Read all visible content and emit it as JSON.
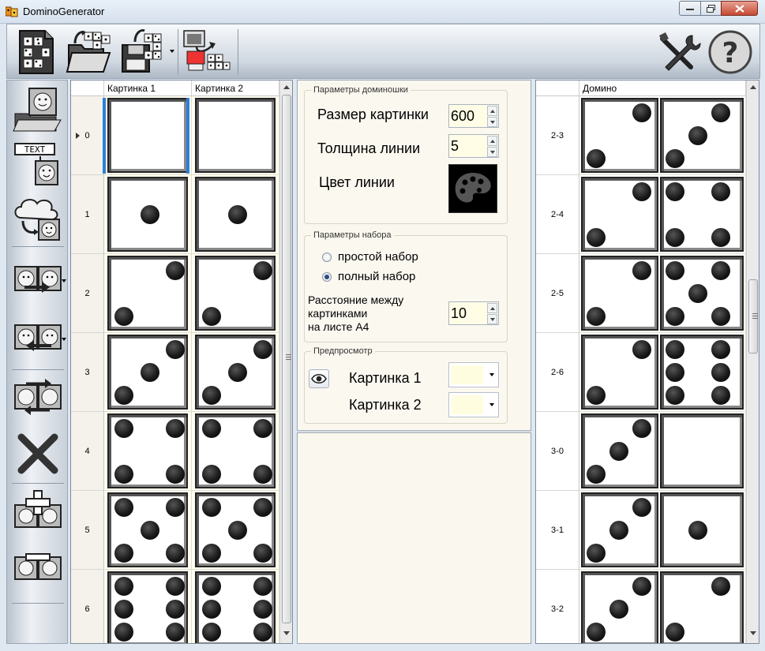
{
  "window": {
    "title": "DominoGenerator"
  },
  "left_grid": {
    "columns": [
      "Картинка 1",
      "Картинка 2"
    ],
    "rows": [
      {
        "label": "0",
        "pips1": 0,
        "pips2": 0
      },
      {
        "label": "1",
        "pips1": 1,
        "pips2": 1
      },
      {
        "label": "2",
        "pips1": 2,
        "pips2": 2
      },
      {
        "label": "3",
        "pips1": 3,
        "pips2": 3
      },
      {
        "label": "4",
        "pips1": 4,
        "pips2": 4
      },
      {
        "label": "5",
        "pips1": 5,
        "pips2": 5
      },
      {
        "label": "6",
        "pips1": 6,
        "pips2": 6
      }
    ]
  },
  "domino_params": {
    "title": "Параметры доминошки",
    "image_size_label": "Размер картинки",
    "image_size_value": "600",
    "line_width_label": "Толщина линии",
    "line_width_value": "5",
    "line_color_label": "Цвет линии"
  },
  "set_params": {
    "title": "Параметры набора",
    "option_simple": "простой набор",
    "option_full": "полный набор",
    "selected": "full",
    "spacing_label_1": "Расстояние между",
    "spacing_label_2": "картинками",
    "spacing_label_3": "на листе А4",
    "spacing_value": "10"
  },
  "preview": {
    "title": "Предпросмотр",
    "image1_label": "Картинка 1",
    "image2_label": "Картинка 2",
    "swatch_color": "#fffde0"
  },
  "right_grid": {
    "column": "Домино",
    "rows": [
      {
        "label": "2-3",
        "a": 2,
        "b": 3
      },
      {
        "label": "2-4",
        "a": 2,
        "b": 4
      },
      {
        "label": "2-5",
        "a": 2,
        "b": 5
      },
      {
        "label": "2-6",
        "a": 2,
        "b": 6
      },
      {
        "label": "3-0",
        "a": 3,
        "b": 0
      },
      {
        "label": "3-1",
        "a": 3,
        "b": 1
      },
      {
        "label": "3-2",
        "a": 3,
        "b": 2
      }
    ]
  },
  "icons": {
    "toolbar": [
      "new-set-icon",
      "open-folder-icon",
      "save-icon",
      "export-print-icon",
      "settings-tools-icon",
      "help-icon"
    ],
    "sidebar": [
      "load-image-icon",
      "text-image-icon",
      "cloud-image-icon",
      "copy-right-icon",
      "copy-left-icon",
      "swap-images-icon",
      "delete-icon",
      "add-row-icon",
      "remove-row-icon"
    ]
  },
  "colors": {
    "selection": "#2e7fd8",
    "cell_bg": "#fffdf0",
    "panel_bg": "#faf7ee"
  }
}
